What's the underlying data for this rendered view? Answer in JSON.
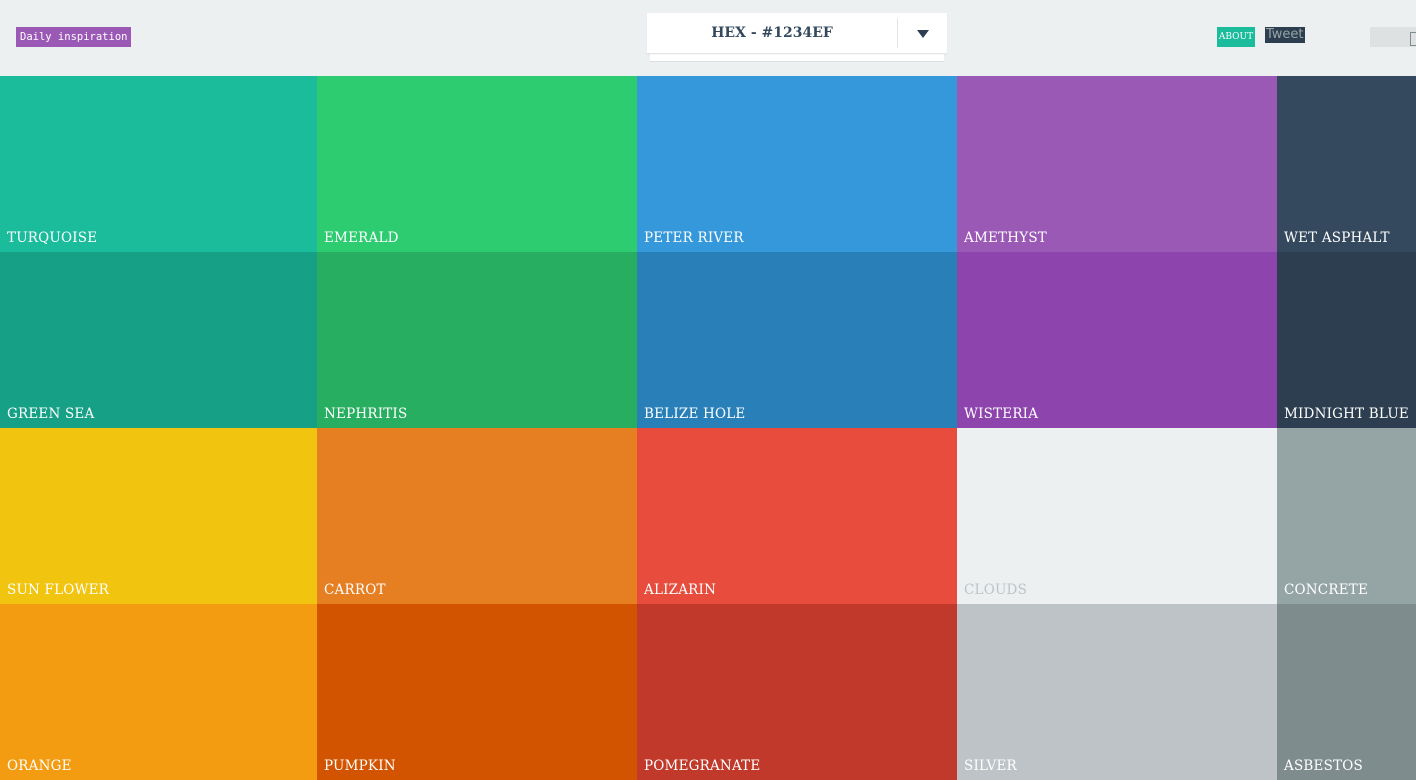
{
  "header": {
    "badge_label": "Daily inspiration",
    "format_value": "HEX - #1234EF",
    "about_label": "ABOUT",
    "tweet_label": "Tweet"
  },
  "icons": {
    "format_caret": "caret-down-icon",
    "extra": "widget-icon"
  },
  "colors": [
    {
      "name": "TURQUOISE",
      "hex": "#1abc9c",
      "label_color": "#ffffff"
    },
    {
      "name": "EMERALD",
      "hex": "#2ecc71",
      "label_color": "#ffffff"
    },
    {
      "name": "PETER RIVER",
      "hex": "#3498db",
      "label_color": "#ffffff"
    },
    {
      "name": "AMETHYST",
      "hex": "#9b59b6",
      "label_color": "#ffffff"
    },
    {
      "name": "WET ASPHALT",
      "hex": "#34495e",
      "label_color": "#ffffff"
    },
    {
      "name": "GREEN SEA",
      "hex": "#16a085",
      "label_color": "#ffffff"
    },
    {
      "name": "NEPHRITIS",
      "hex": "#27ae60",
      "label_color": "#ffffff"
    },
    {
      "name": "BELIZE HOLE",
      "hex": "#2980b9",
      "label_color": "#ffffff"
    },
    {
      "name": "WISTERIA",
      "hex": "#8e44ad",
      "label_color": "#ffffff"
    },
    {
      "name": "MIDNIGHT BLUE",
      "hex": "#2c3e50",
      "label_color": "#ffffff"
    },
    {
      "name": "SUN FLOWER",
      "hex": "#f1c40f",
      "label_color": "#ffffff"
    },
    {
      "name": "CARROT",
      "hex": "#e67e22",
      "label_color": "#ffffff"
    },
    {
      "name": "ALIZARIN",
      "hex": "#e74c3c",
      "label_color": "#ffffff"
    },
    {
      "name": "CLOUDS",
      "hex": "#ecf0f1",
      "label_color": "#bdc3c7"
    },
    {
      "name": "CONCRETE",
      "hex": "#95a5a6",
      "label_color": "#ffffff"
    },
    {
      "name": "ORANGE",
      "hex": "#f39c12",
      "label_color": "#ffffff"
    },
    {
      "name": "PUMPKIN",
      "hex": "#d35400",
      "label_color": "#ffffff"
    },
    {
      "name": "POMEGRANATE",
      "hex": "#c0392b",
      "label_color": "#ffffff"
    },
    {
      "name": "SILVER",
      "hex": "#bdc3c7",
      "label_color": "#ffffff"
    },
    {
      "name": "ASBESTOS",
      "hex": "#7f8c8d",
      "label_color": "#ffffff"
    }
  ]
}
